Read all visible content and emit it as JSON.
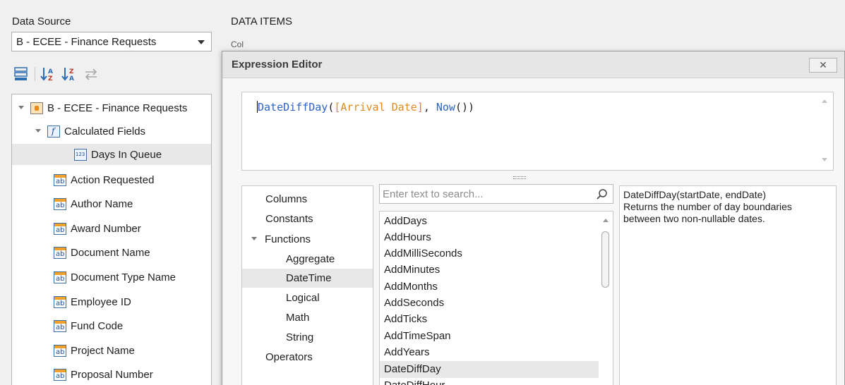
{
  "left_panel": {
    "data_source_label": "Data Source",
    "data_source_value": "B - ECEE - Finance Requests",
    "toolbar_icons": [
      "group-icon",
      "sort-ascending-icon",
      "sort-descending-icon",
      "swap-icon"
    ],
    "tree": {
      "root": "B - ECEE - Finance Requests",
      "calculated_fields_label": "Calculated Fields",
      "calculated_items": [
        "Days In Queue"
      ],
      "fields": [
        "Action Requested",
        "Author Name",
        "Award Number",
        "Document Name",
        "Document Type Name",
        "Employee ID",
        "Fund Code",
        "Project Name",
        "Proposal Number"
      ],
      "icon_text_ab": "ab",
      "icon_text_f": "f",
      "icon_text_123": "123"
    }
  },
  "data_items": {
    "label": "DATA ITEMS",
    "columns_peek": "Col"
  },
  "dialog": {
    "title": "Expression Editor",
    "close_label": "✕",
    "expression": {
      "fn": "DateDiffDay",
      "open": "(",
      "column": "[Arrival Date]",
      "sep": ", ",
      "fn2": "Now",
      "close": "())"
    },
    "categories": {
      "columns": "Columns",
      "constants": "Constants",
      "functions": "Functions",
      "function_groups": [
        "Aggregate",
        "DateTime",
        "Logical",
        "Math",
        "String"
      ],
      "selected_group": "DateTime",
      "operators": "Operators"
    },
    "search": {
      "placeholder": "Enter text to search..."
    },
    "functions": [
      "AddDays",
      "AddHours",
      "AddMilliSeconds",
      "AddMinutes",
      "AddMonths",
      "AddSeconds",
      "AddTicks",
      "AddTimeSpan",
      "AddYears",
      "DateDiffDay",
      "DateDiffHour"
    ],
    "selected_function": "DateDiffDay",
    "description": {
      "signature": "DateDiffDay(startDate, endDate)",
      "text": "Returns the number of day boundaries between two non-nullable dates."
    }
  },
  "colors": {
    "function_token": "#2a63c9",
    "column_token": "#e08a20",
    "selection": "#e8e8e8"
  }
}
